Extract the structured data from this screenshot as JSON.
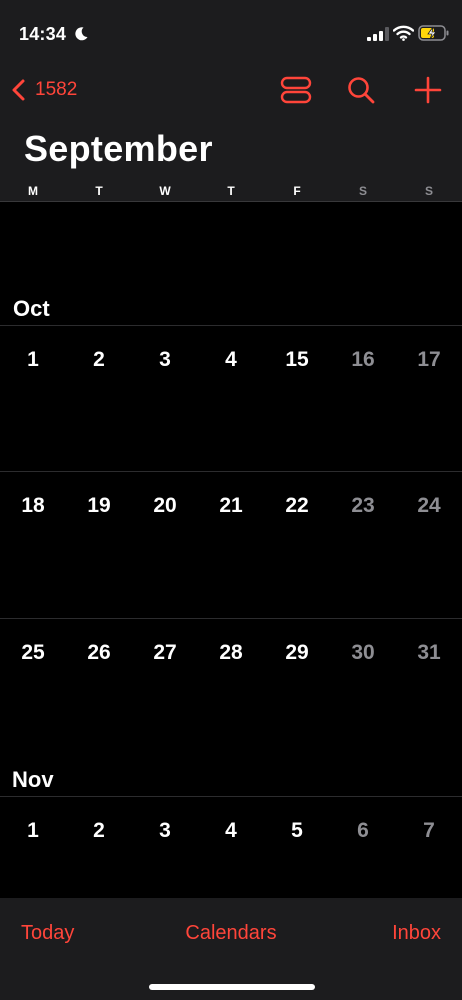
{
  "status": {
    "time": "14:34"
  },
  "nav": {
    "back_label": "1582"
  },
  "header": {
    "month_title": "September",
    "weekdays": [
      "M",
      "T",
      "W",
      "T",
      "F",
      "S",
      "S"
    ]
  },
  "months": [
    {
      "label": "Oct",
      "weeks": [
        [
          "1",
          "2",
          "3",
          "4",
          "15",
          "16",
          "17"
        ],
        [
          "18",
          "19",
          "20",
          "21",
          "22",
          "23",
          "24"
        ],
        [
          "25",
          "26",
          "27",
          "28",
          "29",
          "30",
          "31"
        ]
      ]
    },
    {
      "label": "Nov",
      "weeks": [
        [
          "1",
          "2",
          "3",
          "4",
          "5",
          "6",
          "7"
        ]
      ]
    }
  ],
  "tabs": {
    "today": "Today",
    "calendars": "Calendars",
    "inbox": "Inbox"
  },
  "colors": {
    "accent": "#ff453a",
    "weekend_text": "#8e8e93",
    "bar_bg": "#1c1c1e"
  },
  "icons": {
    "back": "chevron-left-icon",
    "list_toggle": "list-view-icon",
    "search": "search-icon",
    "add": "plus-icon",
    "moon": "moon-icon",
    "signal": "signal-icon",
    "wifi": "wifi-icon",
    "battery": "battery-charging-icon"
  }
}
